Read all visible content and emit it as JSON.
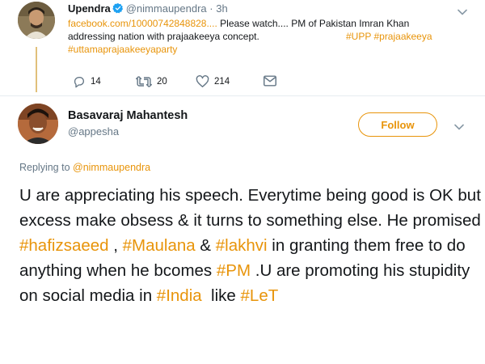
{
  "parent_tweet": {
    "author_name": "Upendra",
    "handle": "@nimmaupendra",
    "time": "· 3h",
    "link": "facebook.com/10000742848828....",
    "text_after_link": " Please watch.... PM of Pakistan Imran Khan",
    "text_line2": "addressing nation with prajaakeeya concept.",
    "tags_line2": "#UPP #prajaakeeya",
    "tag_line3": "#uttamaprajaakeeyaparty",
    "replies": "14",
    "retweets": "20",
    "likes": "214",
    "icons": [
      "reply-icon",
      "retweet-icon",
      "like-icon",
      "message-icon",
      "chevron-down-icon",
      "verified-icon"
    ]
  },
  "reply_tweet": {
    "author_name": "Basavaraj Mahantesh",
    "handle": "@appesha",
    "follow_label": "Follow",
    "replying_prefix": "Replying to ",
    "replying_handle": "@nimmaupendra",
    "body_segments": [
      "U are appreciating his speech. Everytime being good is OK but excess make obsess & it turns to something else. He promised ",
      "#hafizsaeed",
      " , ",
      "#Maulana",
      " & ",
      "#lakhvi",
      " in granting them free to do anything when he bcomes ",
      "#PM",
      " .U are promoting his stupidity on social media in ",
      "#India",
      "  like ",
      "#LeT"
    ]
  },
  "colors": {
    "accent": "#e8940a",
    "verified": "#1da1f2",
    "muted": "#657786",
    "text": "#14171a"
  }
}
